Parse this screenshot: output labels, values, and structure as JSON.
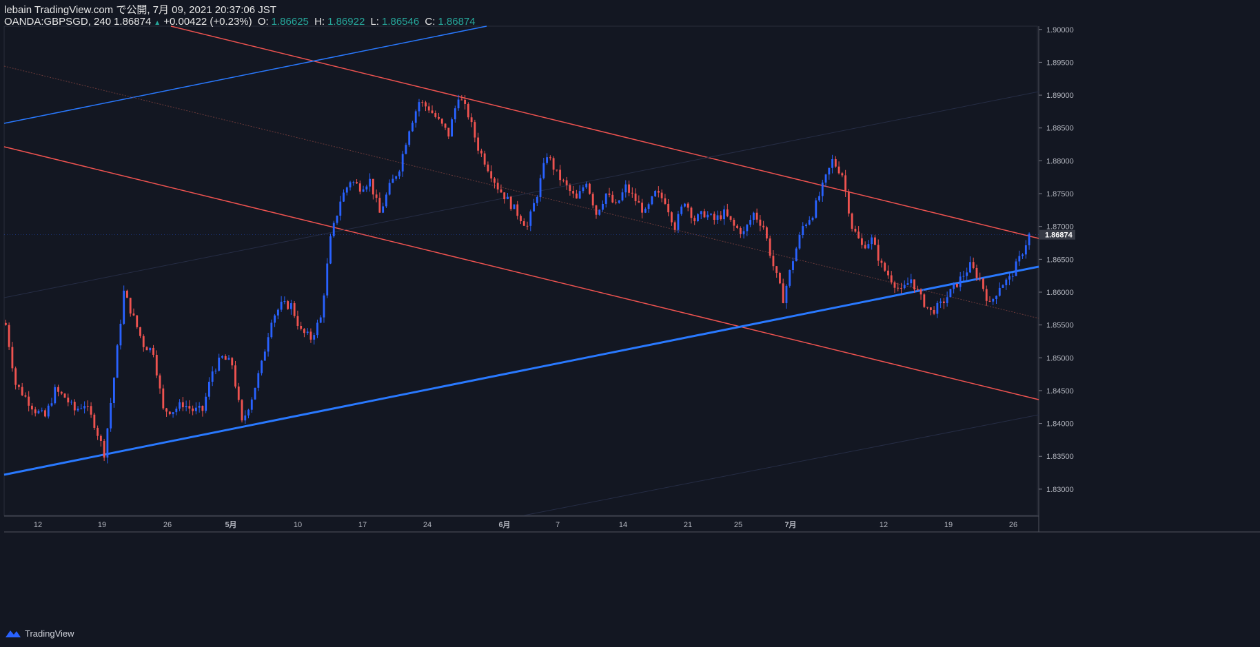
{
  "header": {
    "publish_line": "lebain TradingView.com で公開, 7月 09, 2021 20:37:06 JST",
    "symbol": "OANDA:GBPSGD, 240",
    "last": "1.86874",
    "change": "+0.00422 (+0.23%)",
    "o_label": "O:",
    "o_value": "1.86625",
    "h_label": "H:",
    "h_value": "1.86922",
    "l_label": "L:",
    "l_value": "1.86546",
    "c_label": "C:",
    "c_value": "1.86874"
  },
  "footer": {
    "brand": "TradingView",
    "icon": "tradingview-logo-icon"
  },
  "colors": {
    "background": "#131722",
    "up": "#2962ff",
    "down": "#ef5350",
    "last_price_box": "#363a45"
  },
  "chart_data": {
    "type": "candlestick",
    "title": "",
    "y_ticks": [
      "1.90000",
      "1.89500",
      "1.89000",
      "1.88500",
      "1.88000",
      "1.87500",
      "1.87000",
      "1.86500",
      "1.86000",
      "1.85500",
      "1.85000",
      "1.84500",
      "1.84000",
      "1.83500",
      "1.83000"
    ],
    "ylim": [
      1.826,
      1.9005
    ],
    "x_ticks": [
      "12",
      "19",
      "26",
      "5月",
      "10",
      "17",
      "24",
      "6月",
      "7",
      "14",
      "21",
      "25",
      "7月",
      "12",
      "19",
      "26"
    ],
    "last_price_label": "1.86874",
    "close_path": [
      [
        0,
        1.855
      ],
      [
        3,
        1.846
      ],
      [
        6,
        1.844
      ],
      [
        9,
        1.842
      ],
      [
        12,
        1.841
      ],
      [
        15,
        1.845
      ],
      [
        18,
        1.844
      ],
      [
        21,
        1.842
      ],
      [
        24,
        1.843
      ],
      [
        27,
        1.84
      ],
      [
        30,
        1.8355
      ],
      [
        33,
        1.847
      ],
      [
        36,
        1.86
      ],
      [
        39,
        1.856
      ],
      [
        42,
        1.852
      ],
      [
        45,
        1.851
      ],
      [
        48,
        1.842
      ],
      [
        51,
        1.842
      ],
      [
        54,
        1.843
      ],
      [
        57,
        1.842
      ],
      [
        60,
        1.842
      ],
      [
        63,
        1.848
      ],
      [
        66,
        1.85
      ],
      [
        69,
        1.849
      ],
      [
        72,
        1.84
      ],
      [
        75,
        1.844
      ],
      [
        78,
        1.849
      ],
      [
        81,
        1.856
      ],
      [
        84,
        1.858
      ],
      [
        87,
        1.858
      ],
      [
        90,
        1.854
      ],
      [
        93,
        1.853
      ],
      [
        96,
        1.856
      ],
      [
        99,
        1.868
      ],
      [
        102,
        1.874
      ],
      [
        105,
        1.877
      ],
      [
        108,
        1.876
      ],
      [
        111,
        1.877
      ],
      [
        114,
        1.872
      ],
      [
        117,
        1.876
      ],
      [
        120,
        1.879
      ],
      [
        123,
        1.885
      ],
      [
        126,
        1.889
      ],
      [
        129,
        1.888
      ],
      [
        132,
        1.886
      ],
      [
        135,
        1.884
      ],
      [
        138,
        1.89
      ],
      [
        141,
        1.887
      ],
      [
        144,
        1.882
      ],
      [
        147,
        1.879
      ],
      [
        150,
        1.876
      ],
      [
        153,
        1.874
      ],
      [
        156,
        1.872
      ],
      [
        159,
        1.87
      ],
      [
        162,
        1.875
      ],
      [
        165,
        1.881
      ],
      [
        168,
        1.878
      ],
      [
        171,
        1.876
      ],
      [
        174,
        1.874
      ],
      [
        177,
        1.877
      ],
      [
        180,
        1.872
      ],
      [
        183,
        1.875
      ],
      [
        186,
        1.873
      ],
      [
        189,
        1.876
      ],
      [
        192,
        1.874
      ],
      [
        195,
        1.872
      ],
      [
        198,
        1.875
      ],
      [
        201,
        1.874
      ],
      [
        204,
        1.87
      ],
      [
        207,
        1.874
      ],
      [
        210,
        1.871
      ],
      [
        213,
        1.872
      ],
      [
        216,
        1.871
      ],
      [
        219,
        1.872
      ],
      [
        222,
        1.87
      ],
      [
        225,
        1.869
      ],
      [
        228,
        1.872
      ],
      [
        231,
        1.87
      ],
      [
        234,
        1.864
      ],
      [
        237,
        1.859
      ],
      [
        240,
        1.865
      ],
      [
        243,
        1.87
      ],
      [
        246,
        1.872
      ],
      [
        249,
        1.876
      ],
      [
        252,
        1.88
      ],
      [
        255,
        1.878
      ],
      [
        258,
        1.87
      ],
      [
        261,
        1.867
      ],
      [
        264,
        1.868
      ],
      [
        267,
        1.864
      ],
      [
        270,
        1.862
      ],
      [
        273,
        1.86
      ],
      [
        276,
        1.862
      ],
      [
        279,
        1.859
      ],
      [
        282,
        1.857
      ],
      [
        285,
        1.858
      ],
      [
        288,
        1.86
      ],
      [
        291,
        1.862
      ],
      [
        294,
        1.864
      ],
      [
        297,
        1.862
      ],
      [
        300,
        1.858
      ],
      [
        303,
        1.861
      ],
      [
        306,
        1.862
      ],
      [
        309,
        1.865
      ],
      [
        312,
        1.8687
      ]
    ]
  }
}
